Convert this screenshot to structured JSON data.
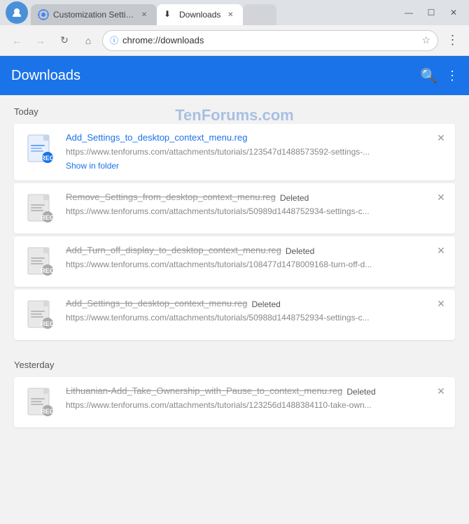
{
  "window": {
    "tabs": [
      {
        "id": "tab-customization",
        "label": "Customization Settings c",
        "favicon": "⚙",
        "active": false
      },
      {
        "id": "tab-downloads",
        "label": "Downloads",
        "favicon": "⬇",
        "active": true
      }
    ],
    "controls": {
      "minimize": "—",
      "maximize": "☐",
      "close": "✕"
    }
  },
  "addressbar": {
    "back": "←",
    "forward": "→",
    "refresh": "↻",
    "home": "⌂",
    "url": "chrome://downloads",
    "star": "☆",
    "menu": "⋮"
  },
  "pageHeader": {
    "title": "Downloads",
    "searchIcon": "🔍",
    "moreIcon": "⋮"
  },
  "watermark": "TenForums.com",
  "sections": [
    {
      "label": "Today",
      "downloads": [
        {
          "id": "dl-1",
          "fileName": "Add_Settings_to_desktop_context_menu.reg",
          "url": "https://www.tenforums.com/attachments/tutorials/123547d1488573592-settings-...",
          "action": "Show in folder",
          "deleted": false,
          "active": true
        },
        {
          "id": "dl-2",
          "fileName": "Remove_Settings_from_desktop_context_menu.reg",
          "url": "https://www.tenforums.com/attachments/tutorials/50989d1448752934-settings-c...",
          "action": null,
          "deleted": true,
          "active": false
        },
        {
          "id": "dl-3",
          "fileName": "Add_Turn_off_display_to_desktop_context_menu.reg",
          "url": "https://www.tenforums.com/attachments/tutorials/108477d1478009168-turn-off-d...",
          "action": null,
          "deleted": true,
          "active": false
        },
        {
          "id": "dl-4",
          "fileName": "Add_Settings_to_desktop_context_menu.reg",
          "url": "https://www.tenforums.com/attachments/tutorials/50988d1448752934-settings-c...",
          "action": null,
          "deleted": true,
          "active": false
        }
      ]
    },
    {
      "label": "Yesterday",
      "downloads": [
        {
          "id": "dl-5",
          "fileName": "Lithuanian-Add_Take_Ownership_with_Pause_to_context_menu.reg",
          "url": "https://www.tenforums.com/attachments/tutorials/123256d1488384110-take-own...",
          "action": null,
          "deleted": true,
          "active": false
        }
      ]
    }
  ],
  "colors": {
    "accent": "#1a73e8",
    "headerBg": "#1a73e8",
    "deletedText": "#999",
    "activeCardBg": "#fff"
  }
}
